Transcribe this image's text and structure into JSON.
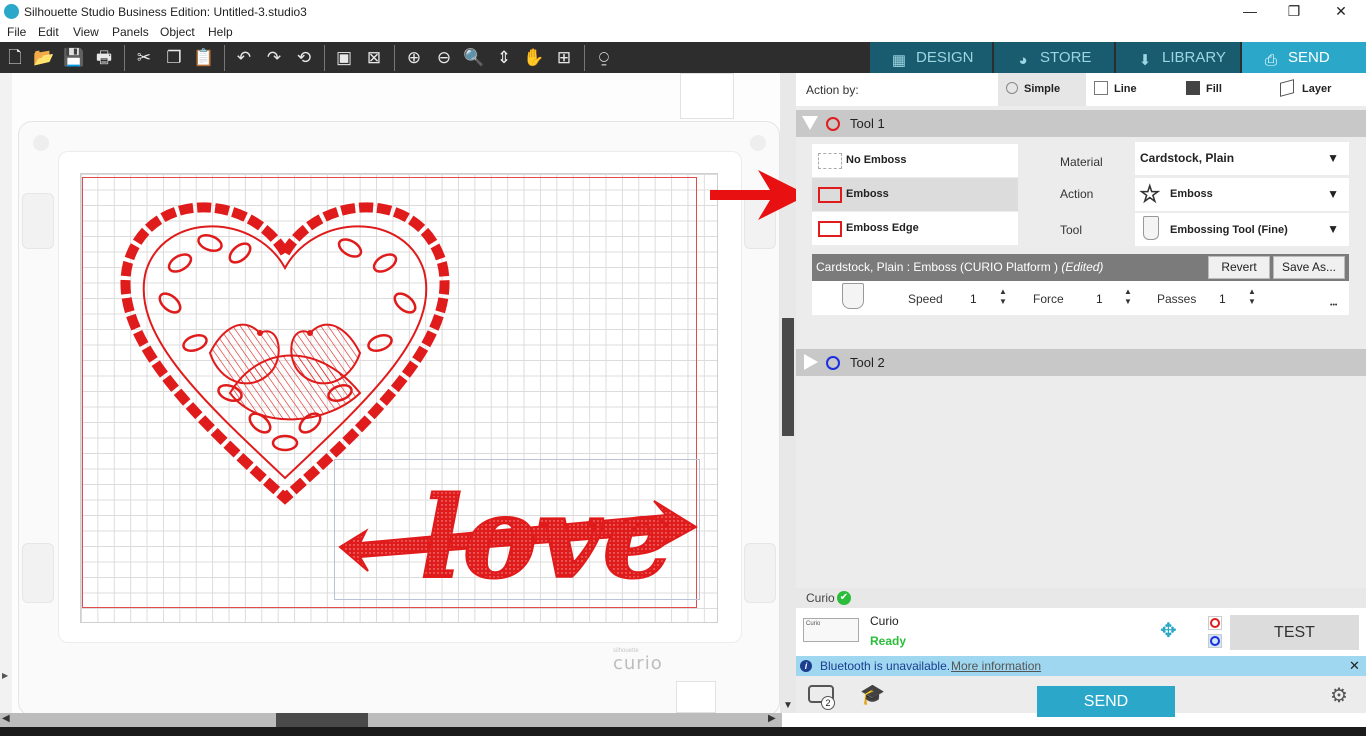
{
  "window": {
    "title": "Silhouette Studio Business Edition: Untitled-3.studio3",
    "min_glyph": "—",
    "max_glyph": "❐",
    "close_glyph": "✕"
  },
  "menubar": [
    "File",
    "Edit",
    "View",
    "Panels",
    "Object",
    "Help"
  ],
  "toolbar_icons": [
    "new-icon",
    "open-icon",
    "save-icon",
    "print-icon",
    "cut-icon",
    "copy-icon",
    "paste-icon",
    "undo-icon",
    "redo-icon",
    "redraw-icon",
    "group-icon",
    "ungroup-icon",
    "zoom-in-icon",
    "zoom-out-icon",
    "zoom-select-icon",
    "fit-page-icon",
    "pan-icon",
    "fit-to-window-icon",
    "trace-icon"
  ],
  "top_tabs": [
    {
      "label": "DESIGN",
      "icon": "grid-icon"
    },
    {
      "label": "STORE",
      "icon": "store-icon"
    },
    {
      "label": "LIBRARY",
      "icon": "library-icon"
    },
    {
      "label": "SEND",
      "icon": "send-icon",
      "active": true
    }
  ],
  "canvas": {
    "design_text": "love",
    "machine_brand": "curio",
    "machine_brand_small": "silhouette"
  },
  "panel": {
    "action_by_label": "Action by:",
    "action_options": [
      {
        "label": "Simple",
        "active": true
      },
      {
        "label": "Line"
      },
      {
        "label": "Fill"
      },
      {
        "label": "Layer"
      }
    ],
    "tool1": {
      "label": "Tool 1",
      "color": "#e01b1b",
      "emboss_options": [
        "No Emboss",
        "Emboss",
        "Emboss Edge"
      ],
      "selected_option": "Emboss",
      "fields": {
        "material_label": "Material",
        "material_value": "Cardstock, Plain",
        "action_label": "Action",
        "action_value": "Emboss",
        "tool_label": "Tool",
        "tool_value": "Embossing Tool (Fine)"
      },
      "preset_text": "Cardstock, Plain : Emboss (CURIO Platform )",
      "preset_edited": "(Edited)",
      "revert_label": "Revert",
      "saveas_label": "Save As...",
      "speed_label": "Speed",
      "speed_value": "1",
      "force_label": "Force",
      "force_value": "1",
      "passes_label": "Passes",
      "passes_value": "1",
      "more_glyph": "•••"
    },
    "tool2": {
      "label": "Tool 2",
      "color": "#1b2ee0"
    },
    "cutter_label": "Curio",
    "device": {
      "name": "Curio",
      "status": "Ready",
      "thumb_label": "Curio"
    },
    "test_label": "TEST",
    "bluetooth_message": "Bluetooth is unavailable.",
    "bluetooth_link": "More information",
    "send_label": "SEND",
    "queue_count": "2"
  },
  "colors": {
    "accent": "#2aa7c9",
    "design_red": "#e01b1b",
    "status_green": "#2bbd3a"
  }
}
